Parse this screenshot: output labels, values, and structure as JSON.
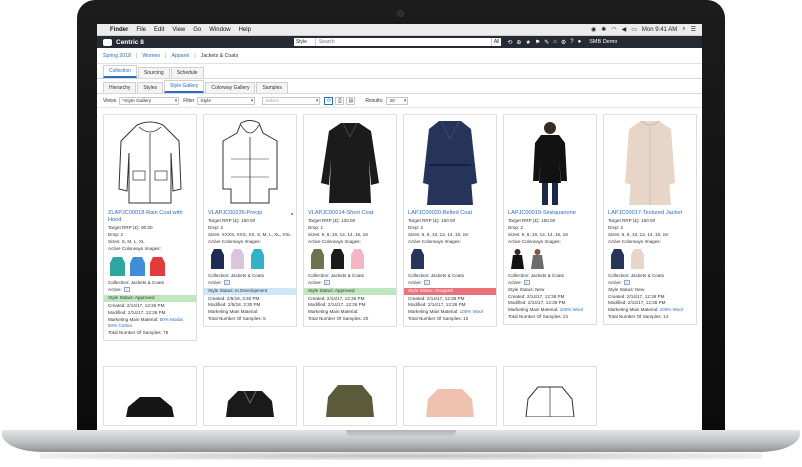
{
  "mac_menu": [
    "Finder",
    "File",
    "Edit",
    "View",
    "Go",
    "Window",
    "Help"
  ],
  "clock": "Mon 9:41 AM",
  "app": {
    "name": "Centric 8",
    "search_scope": "Style",
    "search_placeholder": "Search",
    "search_all": "All",
    "user": "SMB Demo"
  },
  "breadcrumb": [
    "Spring 2018",
    "Women",
    "Apparel",
    "Jackets & Coats"
  ],
  "tabs_primary": [
    "Collection",
    "Sourcing",
    "Schedule"
  ],
  "tabs_secondary": [
    "Hierarchy",
    "Styles",
    "Style Gallery",
    "Colorway Gallery",
    "Samples"
  ],
  "filters": {
    "views_label": "Views",
    "views_value": "*Style Gallery",
    "filter_label": "Filter",
    "filter_value": "Style",
    "select_placeholder": "Select",
    "results_label": "Results:",
    "results_value": "20"
  },
  "card_labels": {
    "target_rrp": "Target RRP (£):",
    "drop": "Drop:",
    "sizes": "Sizes:",
    "colorways": "Active Colorways Images:",
    "collection": "Collection:",
    "active": "Active:",
    "style_status": "Style Status:",
    "created": "Created:",
    "modified": "Modified:",
    "material": "Marketing Main Material:",
    "samples": "Total Number Of Samples:"
  },
  "cards": [
    {
      "title": "ZLAPJC00018-Rain Coat with Hood",
      "rrp": "90.00",
      "drop": "2",
      "sizes": "S, M, L, XL",
      "collection": "Jackets & Coats",
      "status": "Approved",
      "created": "2/14/17, 12:36 PM",
      "modified": "2/14/17, 12:36 PM",
      "material": "50% Modal, 50% Cotton",
      "samples": "75"
    },
    {
      "title": "VLAPJC00236-Precip",
      "rrp": "150.00",
      "drop": "2",
      "sizes": "XXXS, XXS, XS, S, M, L, XL, XXL",
      "collection": "Jackets & Coats",
      "status": "In Development",
      "created": "2/5/18, 3:30 PM",
      "modified": "2/5/18, 3:30 PM",
      "material": "",
      "samples": "5"
    },
    {
      "title": "VLAPJC00014-Short Coat",
      "rrp": "130.00",
      "drop": "1",
      "sizes": "6, 8, 10, 12, 14, 16, 18",
      "collection": "Jackets & Coats",
      "status": "Approved",
      "created": "2/14/17, 12:36 PM",
      "modified": "2/14/17, 12:36 PM",
      "material": "",
      "samples": "20"
    },
    {
      "title": "LAPJC00020-Belted Coat",
      "rrp": "160.00",
      "drop": "2",
      "sizes": "6, 8, 10, 12, 14, 16, 18",
      "collection": "Jackets & Coats",
      "status": "Dropped",
      "created": "2/14/17, 12:36 PM",
      "modified": "2/14/17, 12:36 PM",
      "material": "100% Wool",
      "samples": "10"
    },
    {
      "title": "LAPJC00019-Sinéquanone",
      "rrp": "150.00",
      "drop": "2",
      "sizes": "6, 8, 10, 12, 14, 16, 18",
      "collection": "Jackets & Coats",
      "status": "New",
      "created": "2/14/17, 12:36 PM",
      "modified": "2/14/17, 12:36 PM",
      "material": "100% Wool",
      "samples": "21"
    },
    {
      "title": "LAPJC00017-Textured Jacket",
      "rrp": "160.00",
      "drop": "2",
      "sizes": "6, 8, 10, 12, 14, 16, 18",
      "collection": "Jackets & Coats",
      "status": "New",
      "created": "2/14/17, 12:36 PM",
      "modified": "2/14/17, 12:36 PM",
      "material": "100% Wool",
      "samples": "14"
    }
  ],
  "colors": {
    "brand_blue": "#2b6cc4",
    "header_dark": "#262a33",
    "status_approved": "#bfe6bf",
    "status_in_development": "#cfe6f8",
    "status_dropped": "#e9717a"
  }
}
